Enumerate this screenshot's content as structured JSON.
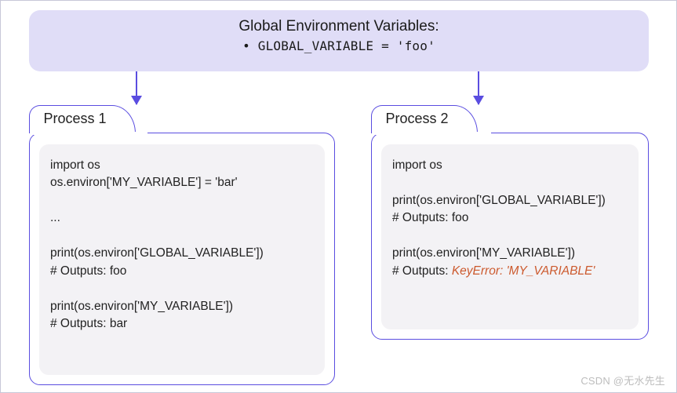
{
  "global": {
    "title": "Global Environment Variables:",
    "var_line": "GLOBAL_VARIABLE = 'foo'"
  },
  "processes": {
    "p1": {
      "label": "Process 1",
      "code_plain": "import os\nos.environ['MY_VARIABLE'] = 'bar'\n\n...\n\nprint(os.environ['GLOBAL_VARIABLE'])\n# Outputs: foo\n\nprint(os.environ['MY_VARIABLE'])\n# Outputs: bar"
    },
    "p2": {
      "label": "Process 2",
      "line1": "import os",
      "line2": "",
      "line3": "print(os.environ['GLOBAL_VARIABLE'])",
      "line4": "# Outputs: foo",
      "line5": "",
      "line6": "print(os.environ['MY_VARIABLE'])",
      "line7_prefix": "# Outputs: ",
      "line7_error": "KeyError: 'MY_VARIABLE'"
    }
  },
  "watermark": "CSDN @无水先生"
}
